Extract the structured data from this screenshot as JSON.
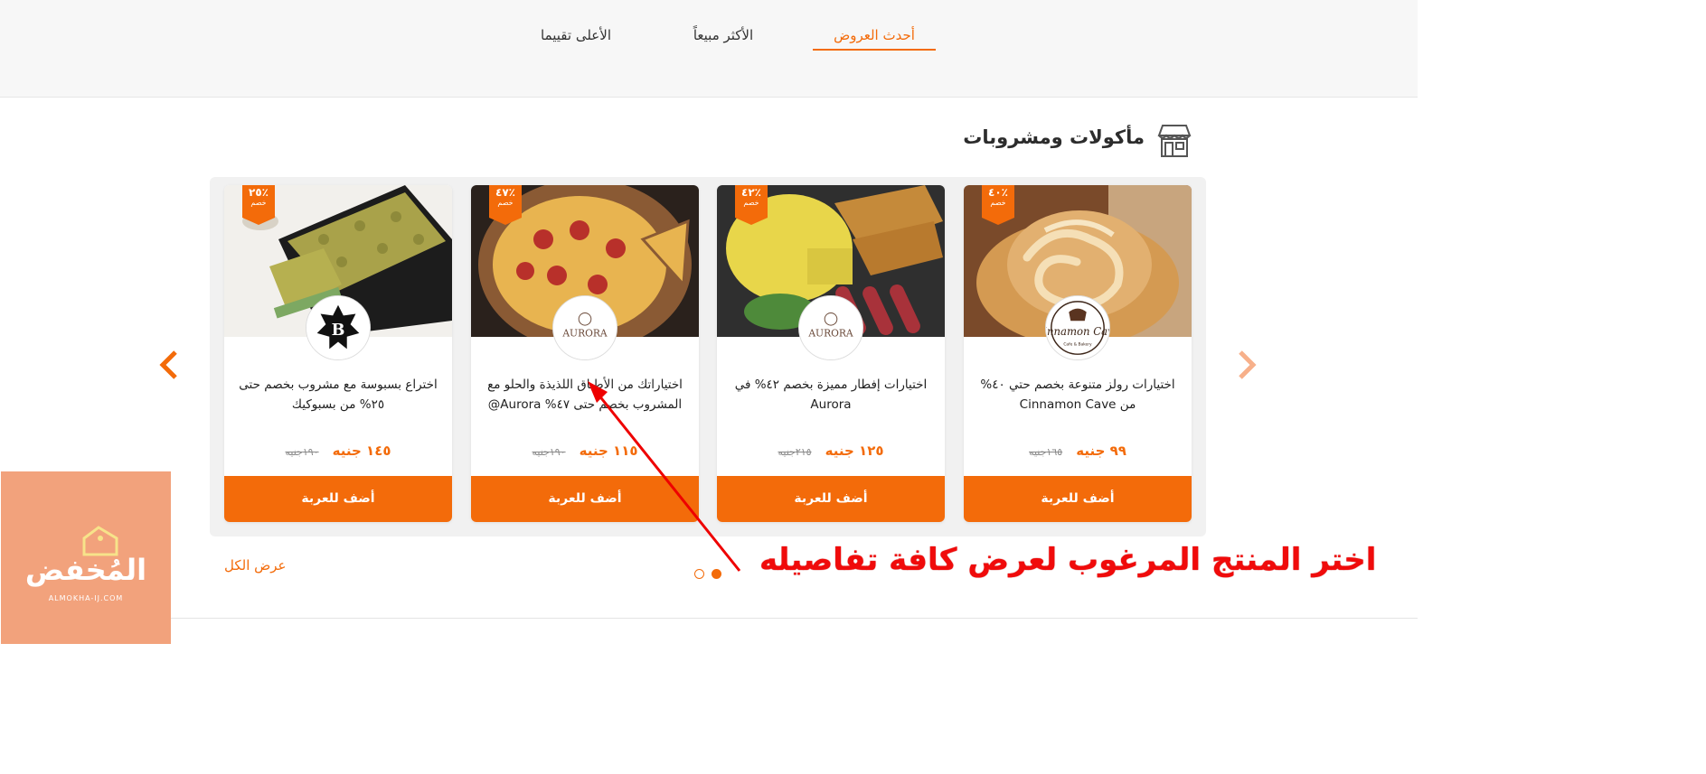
{
  "tabs": [
    {
      "label": "أحدث العروض",
      "active": true
    },
    {
      "label": "الأكثر مبيعاً",
      "active": false
    },
    {
      "label": "الأعلى تقييما",
      "active": false
    }
  ],
  "section": {
    "title": "مأكولات ومشروبات",
    "icon": "store-icon"
  },
  "cards": [
    {
      "discount": "٤٠٪",
      "discount_label": "خصم",
      "title": "اختيارات رولز متنوعة بخصم حتي ٤٠% من Cinnamon Cave",
      "price": "٩٩ جنيه",
      "old_price": "١٦٥جنيه",
      "button": "أضف للعربة",
      "brand": "Cinnamon Cave"
    },
    {
      "discount": "٤٢٪",
      "discount_label": "خصم",
      "title": "اختيارات إفطار مميزة بخصم ٤٢% في Aurora",
      "price": "١٢٥ جنيه",
      "old_price": "٢١٥جنيه",
      "button": "أضف للعربة",
      "brand": "AURORA"
    },
    {
      "discount": "٤٧٪",
      "discount_label": "خصم",
      "title": "اختياراتك من الأطباق اللذيذة والحلو مع المشروب بخصم حتى ٤٧% Aurora@",
      "price": "١١٥ جنيه",
      "old_price": "١٩٠جنيه",
      "button": "أضف للعربة",
      "brand": "AURORA"
    },
    {
      "discount": "٢٥٪",
      "discount_label": "خصم",
      "title": "اختراع بسبوسة مع مشروب بخصم حتى ٢٥% من بسبوكيك",
      "price": "١٤٥ جنيه",
      "old_price": "١٩٠جنيه",
      "button": "أضف للعربة",
      "brand": "B"
    }
  ],
  "see_all": "عرض الكل",
  "annotation": "اختر المنتج المرغوب لعرض كافة تفاصيله",
  "watermark": {
    "text": "المُخفض",
    "sub": "ALMOKHA-IJ.COM"
  },
  "colors": {
    "accent": "#f36b0a",
    "annotation": "#f00b0b",
    "watermark_bg": "#f2a27c"
  }
}
